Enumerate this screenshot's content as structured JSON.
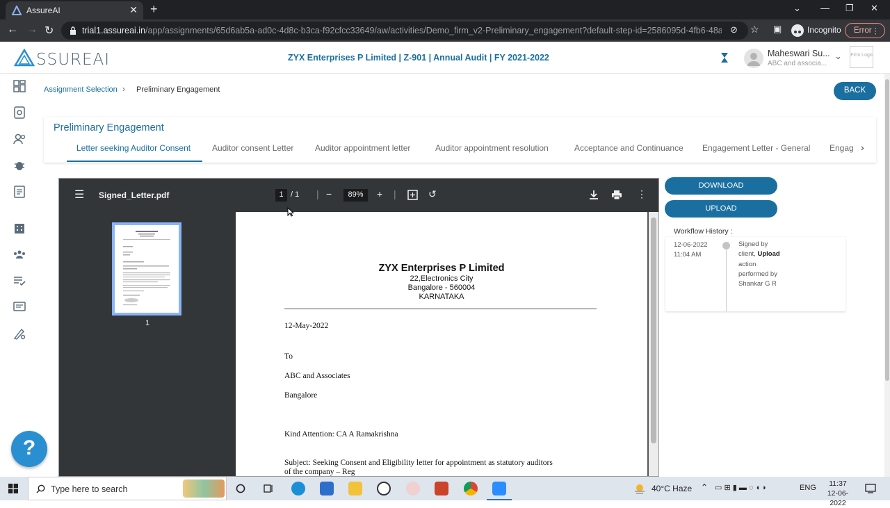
{
  "browser": {
    "tab_title": "AssureAI",
    "url_host": "trial1.assureai.in",
    "url_path": "/app/assignments/65d6ab5a-ad0c-4d8c-b3ca-f92cfcc33649/aw/activities/Demo_firm_v2-Preliminary_engagement?default-step-id=2586095d-4fb6-48a8-a3e4-e1...",
    "incognito_label": "Incognito",
    "error_label": "Error"
  },
  "header": {
    "logo_text": "SSUREAI",
    "title": "ZYX Enterprises P Limited | Z-901 | Annual Audit | FY 2021-2022",
    "user_name": "Maheswari Su...",
    "user_firm": "ABC and associa...",
    "firm_logo_text": "Firm Logo"
  },
  "breadcrumb": {
    "first": "Assignment Selection",
    "current": "Preliminary Engagement"
  },
  "back_label": "BACK",
  "steps": {
    "title": "Preliminary Engagement",
    "tabs": [
      "Letter seeking Auditor Consent",
      "Auditor consent Letter",
      "Auditor appointment letter",
      "Auditor appointment resolution",
      "Acceptance and Continuance",
      "Engagement Letter - General",
      "Engag"
    ],
    "active_index": 0
  },
  "pdf": {
    "filename": "Signed_Letter.pdf",
    "page_current": "1",
    "page_total": "/  1",
    "zoom": "89%",
    "thumb_label": "1",
    "letter": {
      "company": "ZYX Enterprises P Limited",
      "addr1": "22,Electronics City",
      "addr2": "Bangalore - 560004",
      "addr3": "KARNATAKA",
      "date": "12-May-2022",
      "to": "To",
      "to_name": "ABC and Associates",
      "to_city": "Bangalore",
      "attention": "Kind Attention: CA A Ramakrishna",
      "subject_line1": "Subject: Seeking Consent and Eligibility letter for appointment as statutory auditors",
      "subject_line2": "of the company – Reg"
    }
  },
  "actions": {
    "download": "DOWNLOAD",
    "upload": "UPLOAD"
  },
  "workflow": {
    "label": "Workflow History :",
    "date": "12-06-2022",
    "time": "11:04 AM",
    "text_pre": "Signed by client,",
    "action": "Upload",
    "text_post": "action performed by Shankar G R"
  },
  "help_label": "?",
  "taskbar": {
    "search_placeholder": "Type here to search",
    "weather": "40°C  Haze",
    "lang": "ENG",
    "time": "11:37",
    "date": "12-06-2022"
  }
}
